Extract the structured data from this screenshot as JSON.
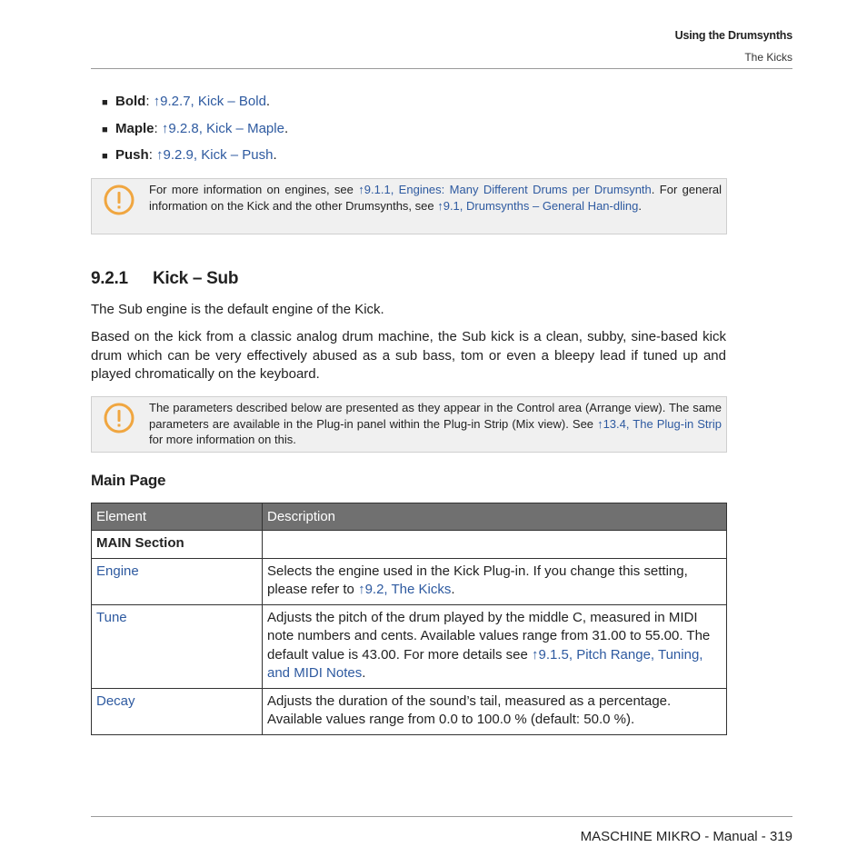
{
  "header": {
    "chapter": "Using the Drumsynths",
    "section": "The Kicks"
  },
  "bullets": [
    {
      "term": "Bold",
      "sep": ": ",
      "link": "↑9.2.7, Kick – Bold",
      "end": "."
    },
    {
      "term": "Maple",
      "sep": ": ",
      "link": "↑9.2.8, Kick – Maple",
      "end": "."
    },
    {
      "term": "Push",
      "sep": ": ",
      "link": "↑9.2.9, Kick – Push",
      "end": "."
    }
  ],
  "note1": {
    "icon": "warning-exclamation-icon",
    "t1": "For more information on engines, see ",
    "link1": "↑9.1.1, Engines: Many Different Drums per Drumsynth",
    "t2": ". For general information on the Kick and the other Drumsynths, see ",
    "link2": "↑9.1, Drumsynths – General Han-dling",
    "t3": "."
  },
  "section": {
    "number": "9.2.1",
    "title": "Kick – Sub",
    "p1": "The Sub engine is the default engine of the Kick.",
    "p2": "Based on the kick from a classic analog drum machine, the Sub kick is a clean, subby, sine-based kick drum which can be very effectively abused as a sub bass, tom or even a bleepy lead if tuned up and played chromatically on the keyboard."
  },
  "note2": {
    "icon": "warning-exclamation-icon",
    "t1": "The parameters described below are presented as they appear in the Control area (Arrange view). The same parameters are available in the Plug-in panel within the Plug-in Strip (Mix view). See ",
    "link1": "↑13.4, The Plug-in Strip",
    "t2": " for more information on this."
  },
  "main_page": {
    "title": "Main Page",
    "columns": [
      "Element",
      "Description"
    ],
    "section_row": "MAIN Section",
    "rows": [
      {
        "element": "Engine",
        "d1": "Selects the engine used in the Kick Plug-in. If you change this setting, please refer to ",
        "link": "↑9.2, The Kicks",
        "d2": "."
      },
      {
        "element": "Tune",
        "d1": "Adjusts the pitch of the drum played by the middle C, measured in MIDI note numbers and cents. Available values range from 31.00 to 55.00. The default value is 43.00. For more details see ",
        "link": "↑9.1.5, Pitch Range, Tuning, and MIDI Notes",
        "d2": "."
      },
      {
        "element": "Decay",
        "d1": "Adjusts the duration of the sound’s tail, measured as a percentage. Available values range from 0.0 to 100.0 % (default: 50.0 %).",
        "link": "",
        "d2": ""
      }
    ]
  },
  "footer": {
    "text": "MASCHINE MIKRO - Manual - 319"
  },
  "colors": {
    "link": "#2e5aa0",
    "warning_icon": "#f0a640",
    "table_header_bg": "#707070",
    "note_bg": "#f0f0f0"
  }
}
